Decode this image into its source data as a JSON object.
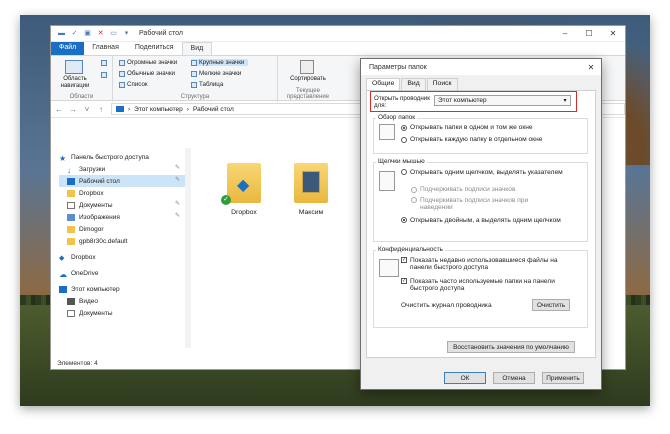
{
  "explorer": {
    "title": "Рабочий стол",
    "tabs": [
      "Файл",
      "Главная",
      "Поделиться",
      "Вид"
    ],
    "ribbon": {
      "nav_pane": "Область навигации",
      "layouts": [
        "Огромные значки",
        "Крупные значки",
        "Обычные значки",
        "Мелкие значки",
        "Список",
        "Таблица"
      ],
      "sort": "Сортировать",
      "groups": [
        "Области",
        "Структура",
        "Текущее представление"
      ]
    },
    "breadcrumb": [
      "Этот компьютер",
      "Рабочий стол"
    ],
    "sidebar": [
      {
        "label": "Панель быстрого доступа",
        "sel": false
      },
      {
        "label": "Загрузки",
        "sel": false
      },
      {
        "label": "Рабочий стол",
        "sel": true
      },
      {
        "label": "Dropbox",
        "sel": false
      },
      {
        "label": "Документы",
        "sel": false
      },
      {
        "label": "Изображения",
        "sel": false
      },
      {
        "label": "Dimogor",
        "sel": false
      },
      {
        "label": "gpb8r30c.default",
        "sel": false
      },
      {
        "label": "Dropbox",
        "sel": false
      },
      {
        "label": "OneDrive",
        "sel": false
      },
      {
        "label": "Этот компьютер",
        "sel": false
      },
      {
        "label": "Видео",
        "sel": false
      },
      {
        "label": "Документы",
        "sel": false
      }
    ],
    "files": [
      "Dropbox",
      "Максим"
    ],
    "status": "Элементов: 4"
  },
  "dialog": {
    "title": "Параметры папок",
    "tabs": [
      "Общие",
      "Вид",
      "Поиск"
    ],
    "open_label": "Открыть проводник для:",
    "open_value": "Этот компьютер",
    "browse_group": "Обзор папок",
    "browse_opts": [
      "Открывать папки в одном и том же окне",
      "Открывать каждую папку в отдельном окне"
    ],
    "click_group": "Щелчки мышью",
    "click_single": "Открывать одним щелчком, выделять указателем",
    "underline_1": "Подчеркивать подписи значков",
    "underline_2": "Подчеркивать подписи значков при наведении",
    "click_double": "Открывать двойным, а выделять одним щелчком",
    "privacy_group": "Конфиденциальность",
    "privacy_1": "Показать недавно использовавшиеся файлы на панели быстрого доступа",
    "privacy_2": "Показать часто используемые папки на панели быстрого доступа",
    "clear_label": "Очистить журнал проводника",
    "clear_btn": "Очистить",
    "restore_btn": "Восстановить значения по умолчанию",
    "ok": "ОК",
    "cancel": "Отмена",
    "apply": "Применить"
  },
  "colors": {
    "accent": "#1a6fc4",
    "highlight": "#d92c2c",
    "selection": "#cce4f7"
  }
}
